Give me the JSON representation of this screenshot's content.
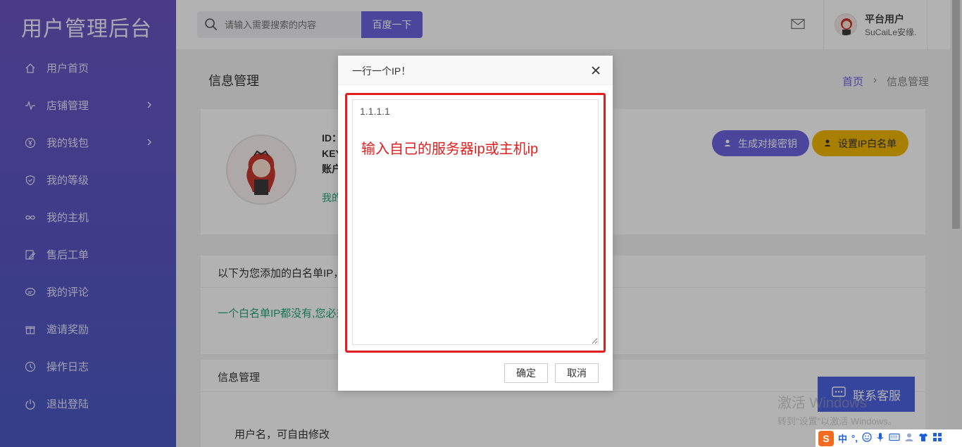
{
  "sidebar": {
    "brand": "用户管理后台",
    "items": [
      {
        "label": "用户首页",
        "icon": "home-icon",
        "has_arrow": false
      },
      {
        "label": "店铺管理",
        "icon": "pulse-icon",
        "has_arrow": true
      },
      {
        "label": "我的钱包",
        "icon": "yen-icon",
        "has_arrow": true
      },
      {
        "label": "我的等级",
        "icon": "shield-icon",
        "has_arrow": false
      },
      {
        "label": "我的主机",
        "icon": "infinity-icon",
        "has_arrow": false
      },
      {
        "label": "售后工单",
        "icon": "edit-icon",
        "has_arrow": false
      },
      {
        "label": "我的评论",
        "icon": "comment-icon",
        "has_arrow": false
      },
      {
        "label": "邀请奖励",
        "icon": "gift-icon",
        "has_arrow": false
      },
      {
        "label": "操作日志",
        "icon": "clock-icon",
        "has_arrow": false
      },
      {
        "label": "退出登陆",
        "icon": "power-icon",
        "has_arrow": false
      }
    ]
  },
  "topbar": {
    "search_placeholder": "请输入需要搜索的内容",
    "search_button": "百度一下",
    "user_name": "平台用户",
    "user_sub": "SuCaiLe安缘."
  },
  "page": {
    "title": "信息管理",
    "breadcrumb_home": "首页",
    "breadcrumb_sep": "›",
    "breadcrumb_current": "信息管理"
  },
  "profile_card": {
    "line1": "ID：",
    "line2": "KEY",
    "line3": "账户",
    "green_text": "我的",
    "btn_generate": "生成对接密钥",
    "btn_whitelist": "设置IP白名单"
  },
  "whitelist_card": {
    "header": "以下为您添加的白名单IP，",
    "empty_text": "一个白名单IP都没有,您必须"
  },
  "info_card": {
    "header": "信息管理",
    "row1": "用户名，可自由修改"
  },
  "dialog": {
    "title": "一行一个IP！",
    "textarea_value": "1.1.1.1",
    "annotation": "输入自己的服务器ip或主机ip",
    "ok_label": "确定",
    "cancel_label": "取消"
  },
  "customer_service": "联系客服",
  "watermark": {
    "line1": "激活 Windows",
    "line2": "转到\"设置\"以激活 Windows。"
  },
  "tray": {
    "ime_logo": "S",
    "ime_lang": "中",
    "ime_punct": "°,"
  },
  "colors": {
    "sidebar_top": "#6a55c3",
    "sidebar_bottom": "#4d5ac4",
    "accent": "#6c63e0",
    "warning": "#f2b600",
    "success": "#20a77a",
    "annotation": "#e02020"
  }
}
